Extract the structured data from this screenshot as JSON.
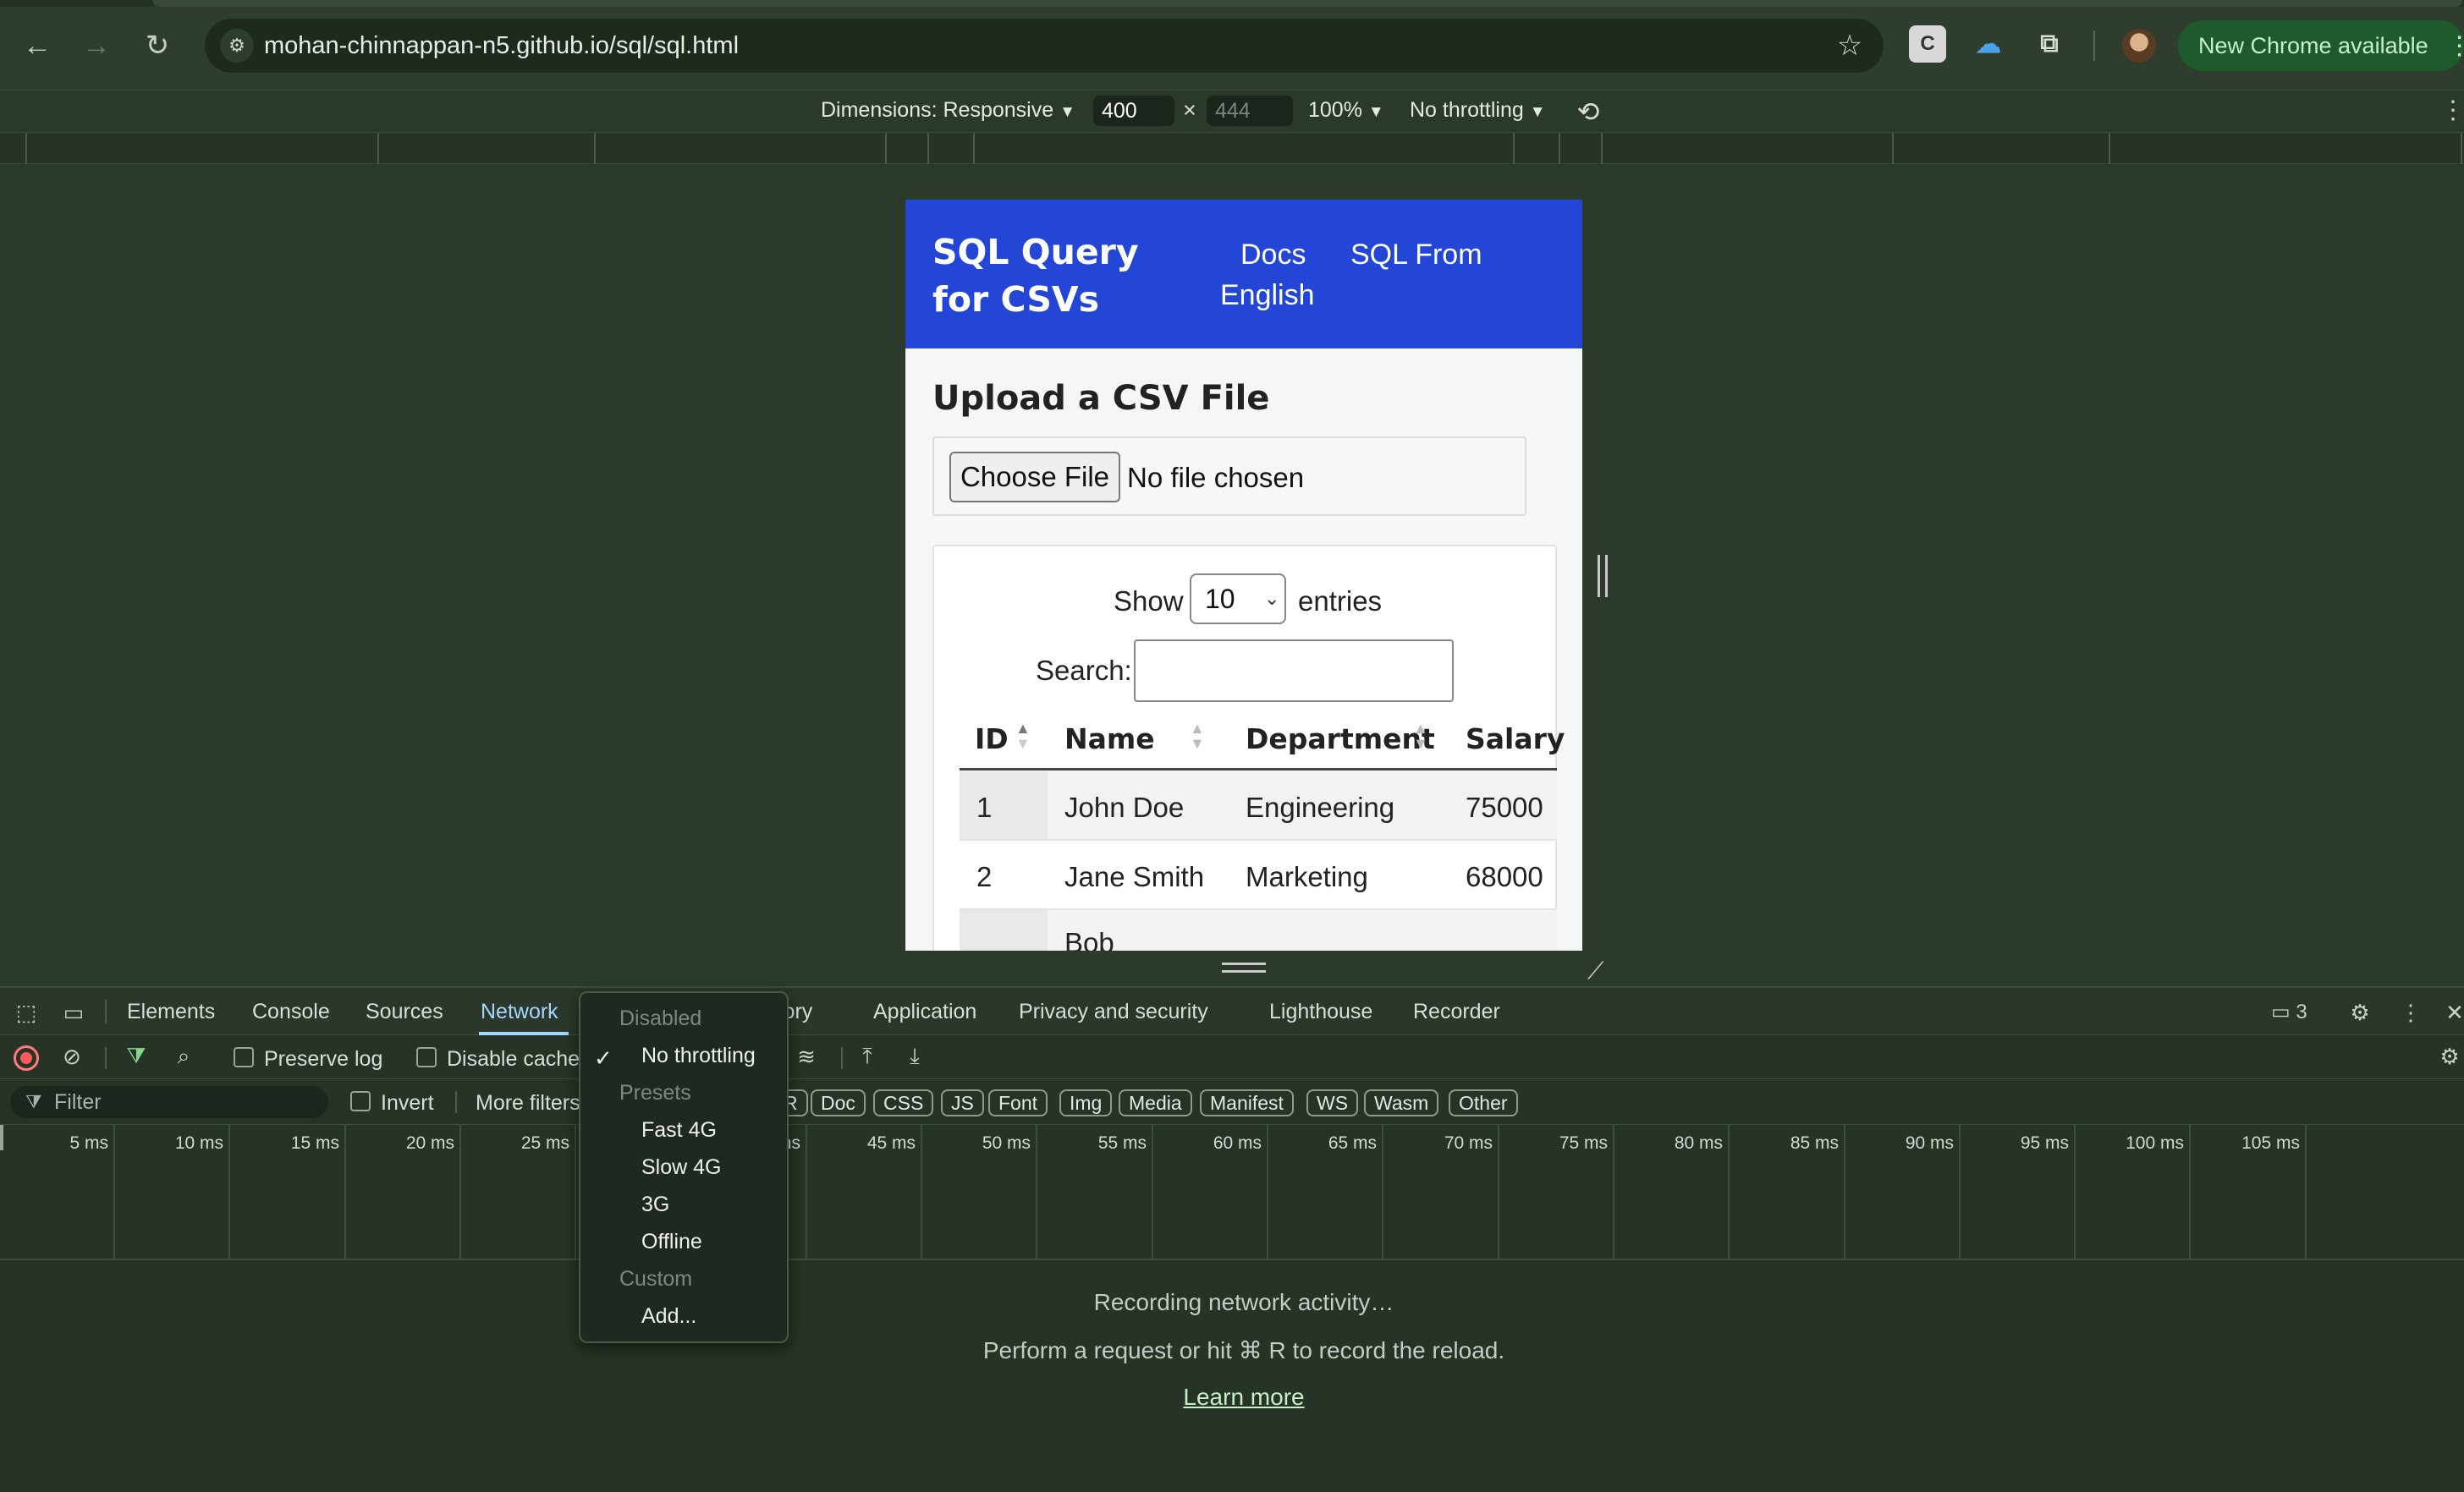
{
  "browser": {
    "url": "mohan-chinnappan-n5.github.io/sql/sql.html",
    "update_button": "New Chrome available"
  },
  "device_toolbar": {
    "dimensions": "Dimensions: Responsive",
    "width": "400",
    "times": "×",
    "height": "444",
    "zoom": "100%",
    "throttle": "No throttling"
  },
  "page": {
    "title": "SQL Query for CSVs",
    "nav": [
      "Docs",
      "SQL From",
      "English"
    ],
    "upload_heading": "Upload a CSV File",
    "choose_file": "Choose File",
    "no_file": "No file chosen",
    "show_label": "Show",
    "entries_value": "10",
    "entries_label": "entries",
    "search_label": "Search:",
    "columns": [
      "ID",
      "Name",
      "Department",
      "Salary"
    ],
    "rows": [
      [
        "1",
        "John Doe",
        "Engineering",
        "75000"
      ],
      [
        "2",
        "Jane Smith",
        "Marketing",
        "68000"
      ],
      [
        "",
        "Bob",
        "",
        ""
      ]
    ]
  },
  "devtools": {
    "tabs": [
      "Elements",
      "Console",
      "Sources",
      "Network",
      "Memory",
      "Application",
      "Privacy and security",
      "Lighthouse",
      "Recorder"
    ],
    "issues_count": "3",
    "preserve_log": "Preserve log",
    "disable_cache": "Disable cache",
    "filter_placeholder": "Filter",
    "invert": "Invert",
    "more_filters": "More filters",
    "type_chips": [
      "R",
      "Doc",
      "CSS",
      "JS",
      "Font",
      "Img",
      "Media",
      "Manifest",
      "WS",
      "Wasm",
      "Other"
    ],
    "timeline_labels": [
      "5 ms",
      "10 ms",
      "15 ms",
      "20 ms",
      "25 ms",
      "s",
      "40 ms",
      "45 ms",
      "50 ms",
      "55 ms",
      "60 ms",
      "65 ms",
      "70 ms",
      "75 ms",
      "80 ms",
      "85 ms",
      "90 ms",
      "95 ms",
      "100 ms",
      "105 ms"
    ],
    "recording": "Recording network activity…",
    "perform": "Perform a request or hit ⌘ R to record the reload.",
    "learn_more": "Learn more"
  },
  "throttle_menu": {
    "disabled_header": "Disabled",
    "selected": "No throttling",
    "presets_header": "Presets",
    "presets": [
      "Fast 4G",
      "Slow 4G",
      "3G",
      "Offline"
    ],
    "custom_header": "Custom",
    "add": "Add..."
  }
}
